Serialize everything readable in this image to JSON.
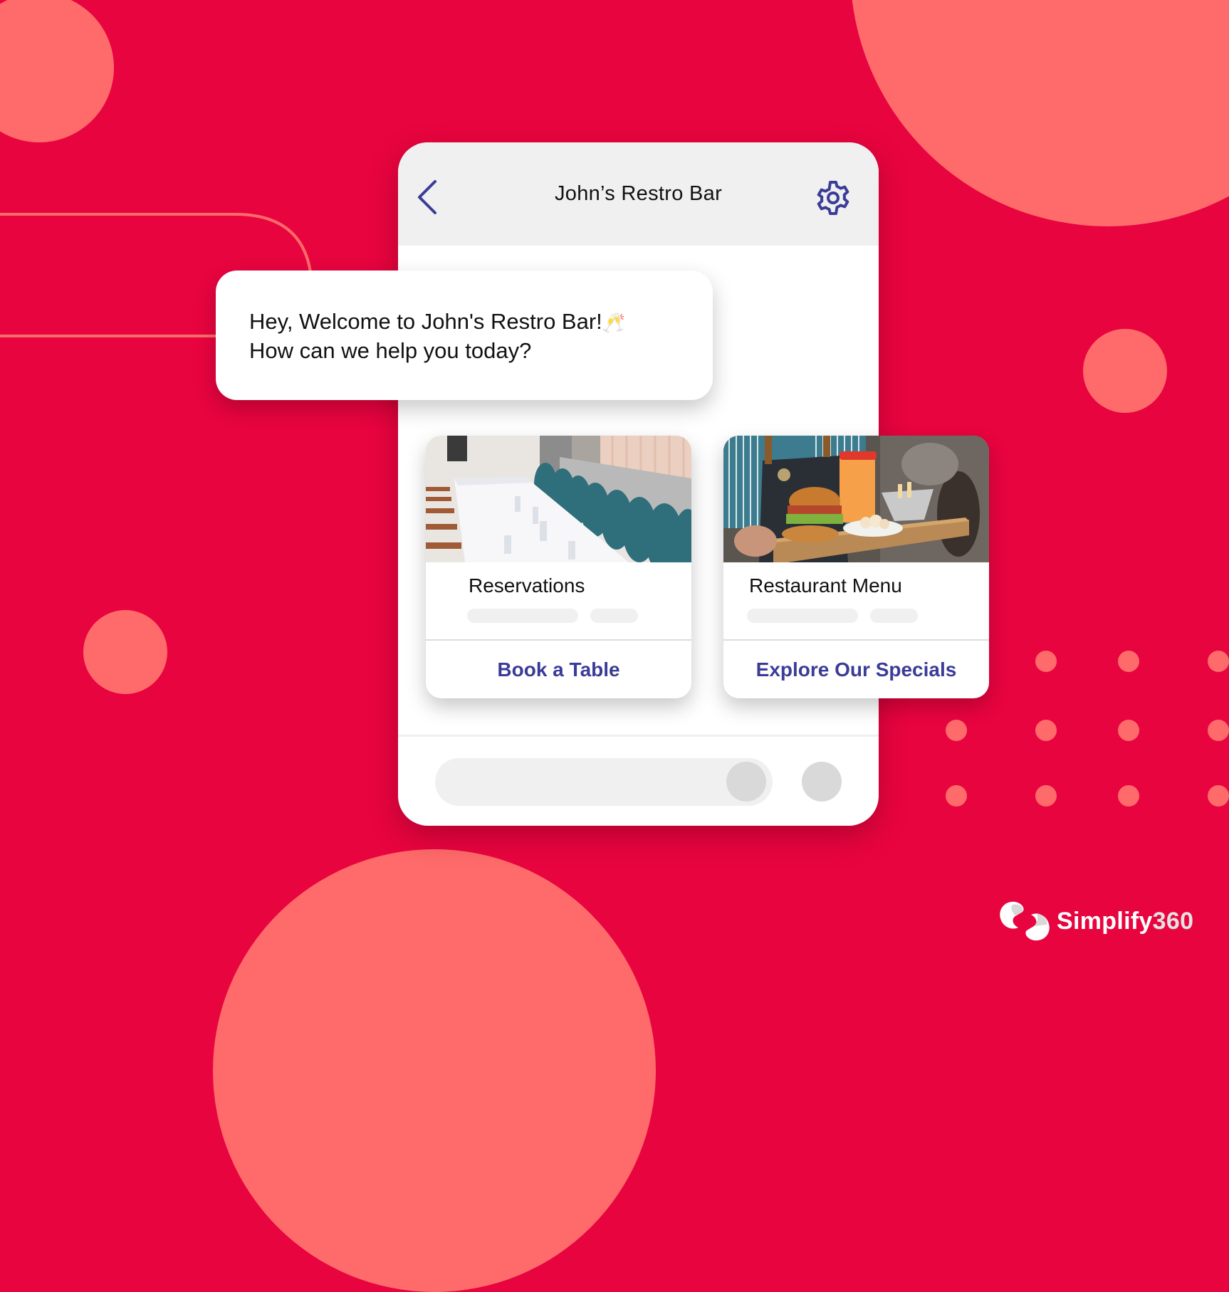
{
  "colors": {
    "background": "#E8043F",
    "decoration": "#FF6B6B",
    "accent": "#3B3C97",
    "header_bg": "#F0F0F0",
    "placeholder": "#D9D9D9"
  },
  "phone": {
    "header": {
      "title": "John’s Restro Bar",
      "back_icon": "chevron-left-icon",
      "settings_icon": "gear-icon"
    },
    "composer": {
      "input_value": "",
      "input_placeholder": "",
      "attach_icon": "circle-placeholder-icon",
      "send_icon": "circle-placeholder-icon"
    }
  },
  "welcome_bubble": {
    "line1": "Hey, Welcome to John's Restro Bar!",
    "emoji": "🥂",
    "line2": "How can we help you today?"
  },
  "cards": [
    {
      "title": "Reservations",
      "image": "restaurant-dining-tables-photo",
      "action_label": "Book a Table"
    },
    {
      "title": "Restaurant Menu",
      "image": "burger-drink-tray-photo",
      "action_label": "Explore Our Specials"
    }
  ],
  "brand": {
    "name_part1": "Simplify",
    "name_part2": "360"
  }
}
